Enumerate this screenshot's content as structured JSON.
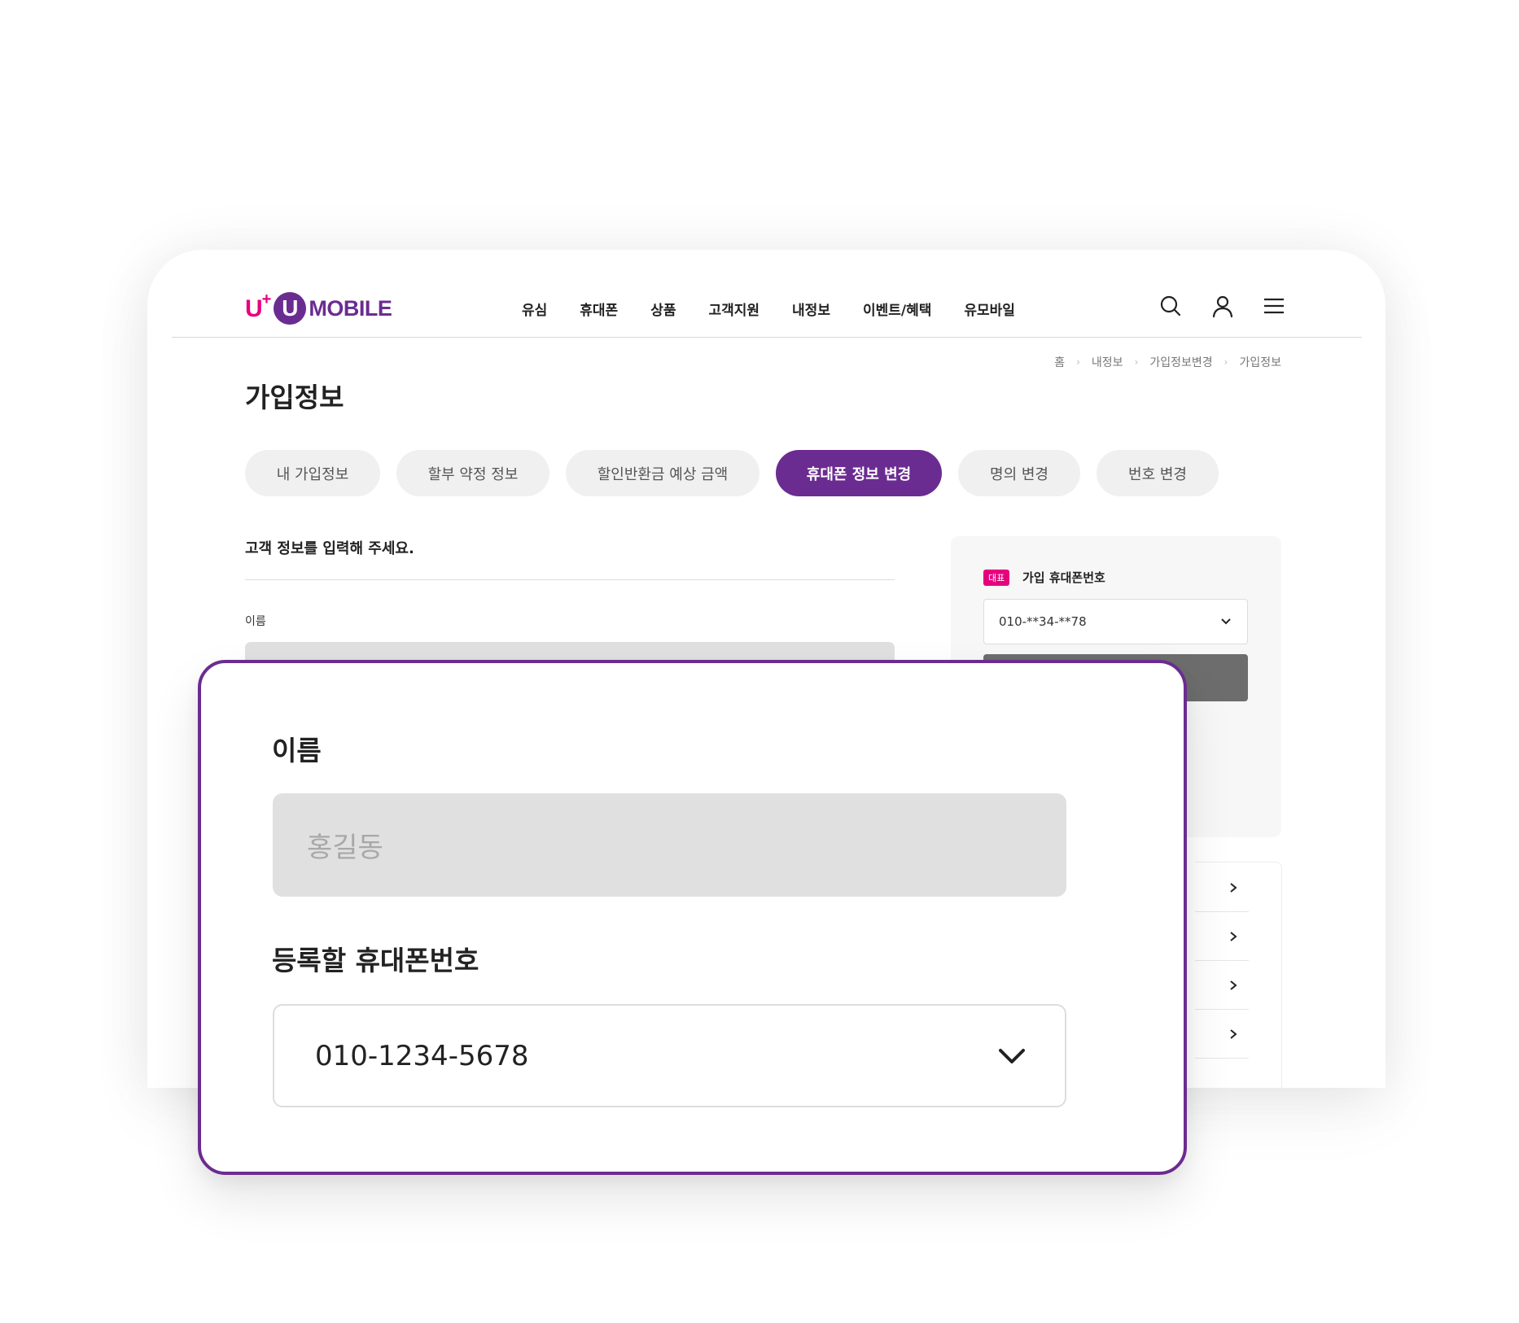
{
  "header": {
    "logo": {
      "uplus": "U",
      "plus": "+",
      "u": "U",
      "mobile": "MOBILE"
    },
    "nav": [
      "유심",
      "휴대폰",
      "상품",
      "고객지원",
      "내정보",
      "이벤트/혜택",
      "유모바일"
    ],
    "icons": [
      "search-icon",
      "user-icon",
      "menu-icon"
    ]
  },
  "breadcrumb": [
    "홈",
    "내정보",
    "가입정보변경",
    "가입정보"
  ],
  "page": {
    "title": "가입정보"
  },
  "tabs": [
    {
      "label": "내 가입정보",
      "active": false
    },
    {
      "label": "할부 약정 정보",
      "active": false
    },
    {
      "label": "할인반환금 예상 금액",
      "active": false
    },
    {
      "label": "휴대폰 정보 변경",
      "active": true
    },
    {
      "label": "명의 변경",
      "active": false
    },
    {
      "label": "번호 변경",
      "active": false
    }
  ],
  "form": {
    "heading": "고객 정보를 입력해 주세요.",
    "name_label": "이름"
  },
  "side": {
    "badge": "대표",
    "label": "가입 휴대폰번호",
    "selected_number": "010-**34-**78"
  },
  "zoom": {
    "name_label": "이름",
    "name_placeholder": "홍길동",
    "phone_label": "등록할 휴대폰번호",
    "phone_value": "010-1234-5678"
  },
  "colors": {
    "brand_purple": "#6b2c91",
    "brand_pink": "#e6007e"
  }
}
